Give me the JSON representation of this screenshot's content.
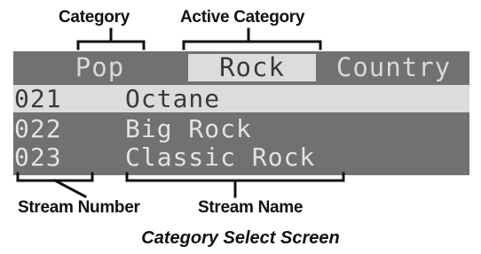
{
  "callouts": {
    "category": "Category",
    "active_category": "Active Category",
    "stream_number": "Stream Number",
    "stream_name": "Stream Name"
  },
  "caption": "Category Select Screen",
  "screen": {
    "tabs": [
      {
        "label": "Pop",
        "active": false
      },
      {
        "label": "Rock",
        "active": true
      },
      {
        "label": "Country",
        "active": false
      }
    ],
    "streams": [
      {
        "number": "021",
        "name": "Octane",
        "selected": true
      },
      {
        "number": "022",
        "name": "Big Rock",
        "selected": false
      },
      {
        "number": "023",
        "name": "Classic Rock",
        "selected": false
      }
    ]
  },
  "colors": {
    "lcd_background": "#717171",
    "highlight": "#dcdcdc",
    "lcd_text": "#e2e2e2"
  }
}
